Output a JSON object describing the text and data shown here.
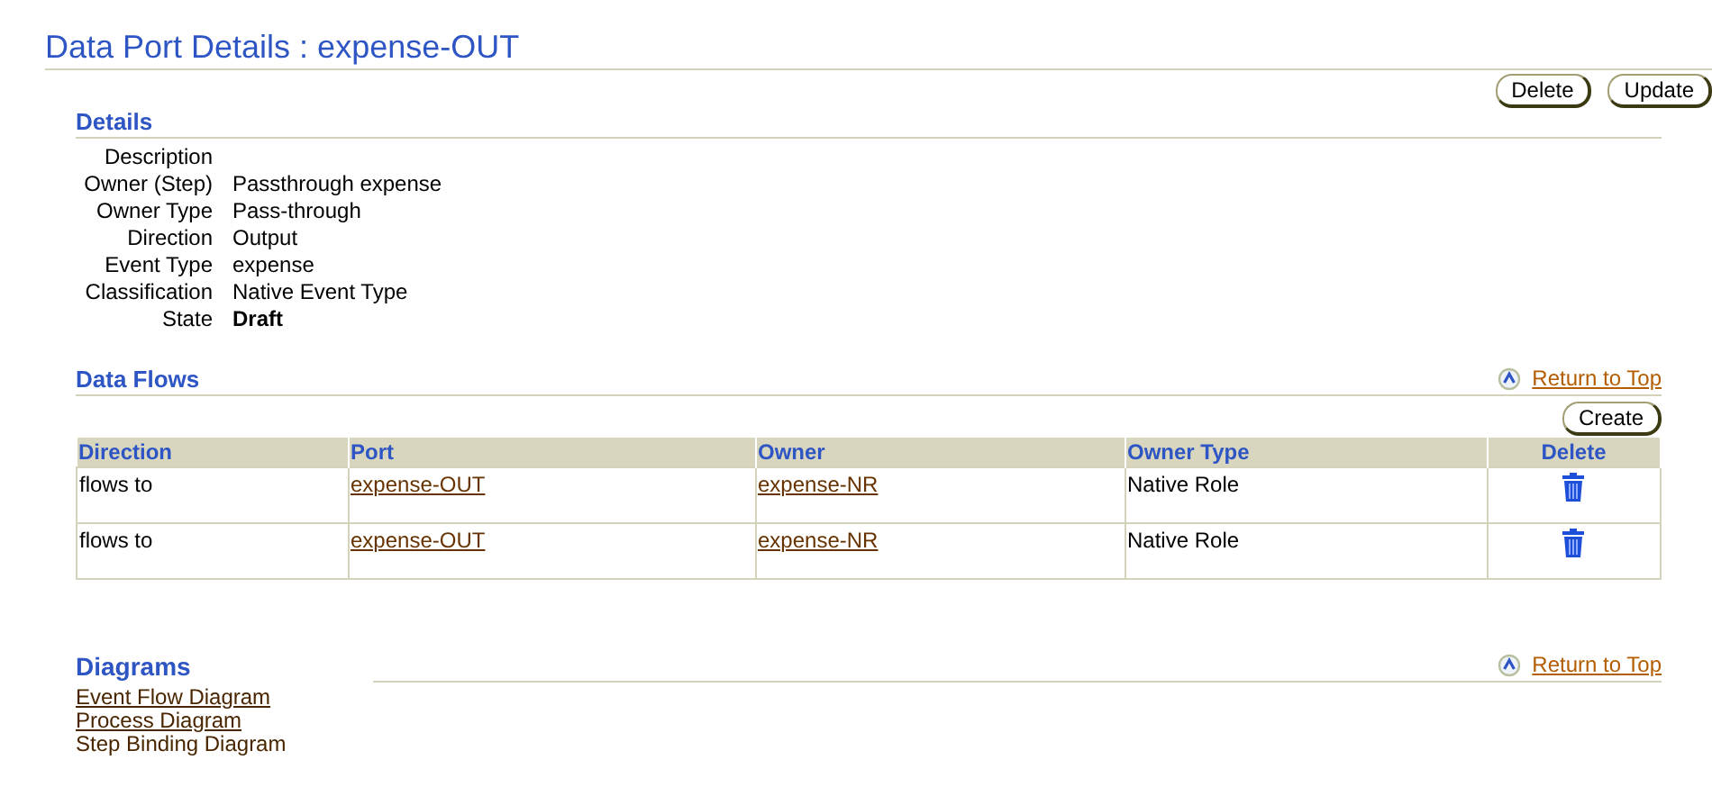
{
  "title": "Data Port Details : expense-OUT",
  "top_buttons": [
    "Delete",
    "Update"
  ],
  "details": {
    "heading": "Details",
    "fields": [
      {
        "label": "Description"
      },
      {
        "label": "Owner (Step)",
        "value": "Passthrough expense"
      },
      {
        "label": "Owner Type",
        "value": "Pass-through"
      },
      {
        "label": "Direction",
        "value": "Output"
      },
      {
        "label": "Event Type",
        "value": "expense"
      },
      {
        "label": "Classification",
        "value": "Native Event Type"
      }
    ],
    "state": {
      "label": "State",
      "value": "Draft"
    }
  },
  "data_flows": {
    "heading": "Data Flows",
    "return_link": "Return to Top",
    "create_button": "Create",
    "columns": [
      "Direction",
      "Port",
      "Owner",
      "Owner Type",
      "Delete"
    ],
    "rows": [
      {
        "direction": "flows to",
        "port": "expense-OUT",
        "owner": "expense-NR",
        "owner_type": "Native Role"
      },
      {
        "direction": "flows to",
        "port": "expense-OUT",
        "owner": "expense-NR",
        "owner_type": "Native Role"
      }
    ]
  },
  "diagrams": {
    "heading": "Diagrams",
    "return_link": "Return to Top",
    "links": [
      {
        "label": "Event Flow Diagram",
        "underlined": true
      },
      {
        "label": "Process Diagram",
        "underlined": true
      },
      {
        "label": "Step Binding Diagram",
        "underlined": false
      }
    ]
  }
}
